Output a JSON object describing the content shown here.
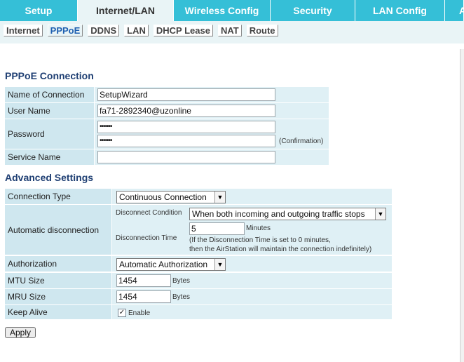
{
  "nav": {
    "tabs": [
      "Setup",
      "Internet/LAN",
      "Wireless Config",
      "Security",
      "LAN Config",
      "A"
    ],
    "active_tab": "Internet/LAN"
  },
  "subnav": {
    "links": [
      "Internet",
      "PPPoE",
      "DDNS",
      "LAN",
      "DHCP Lease",
      "NAT",
      "Route"
    ],
    "active_link": "PPPoE"
  },
  "pppoe": {
    "heading": "PPPoE Connection",
    "name_label": "Name of Connection",
    "name_value": "SetupWizard",
    "user_label": "User Name",
    "user_value": "fa71-2892340@uzonline",
    "password_label": "Password",
    "password_mask": "•••••••",
    "confirm_mask": "•••••••",
    "confirmation_note": "(Confirmation)",
    "service_label": "Service Name",
    "service_value": ""
  },
  "advanced": {
    "heading": "Advanced Settings",
    "conn_type_label": "Connection Type",
    "conn_type_value": "Continuous Connection",
    "auto_disc_label": "Automatic disconnection",
    "disc_condition_label": "Disconnect Condition",
    "disc_condition_value": "When both incoming and outgoing traffic stops",
    "disc_time_label": "Disconnection Time",
    "disc_time_value": "5",
    "minutes_label": "Minutes",
    "note_line1": "(If the Disconnection Time is set to 0 minutes,",
    "note_line2": "then the AirStation will maintain the connection indefinitely)",
    "auth_label": "Authorization",
    "auth_value": "Automatic Authorization",
    "mtu_label": "MTU Size",
    "mtu_value": "1454",
    "mtu_unit": "Bytes",
    "mru_label": "MRU Size",
    "mru_value": "1454",
    "mru_unit": "Bytes",
    "keepalive_label": "Keep Alive",
    "keepalive_checked": true,
    "keepalive_enable": "Enable"
  },
  "apply_label": "Apply",
  "icons": [
    "chevron-down-icon",
    "checkmark-icon"
  ],
  "colors": {
    "nav_bg": "#35bfd7",
    "subnav_bg": "#e9f4f6",
    "label_bg": "#cfe7ef",
    "value_bg": "#dff0f5",
    "heading": "#1f3f73"
  }
}
